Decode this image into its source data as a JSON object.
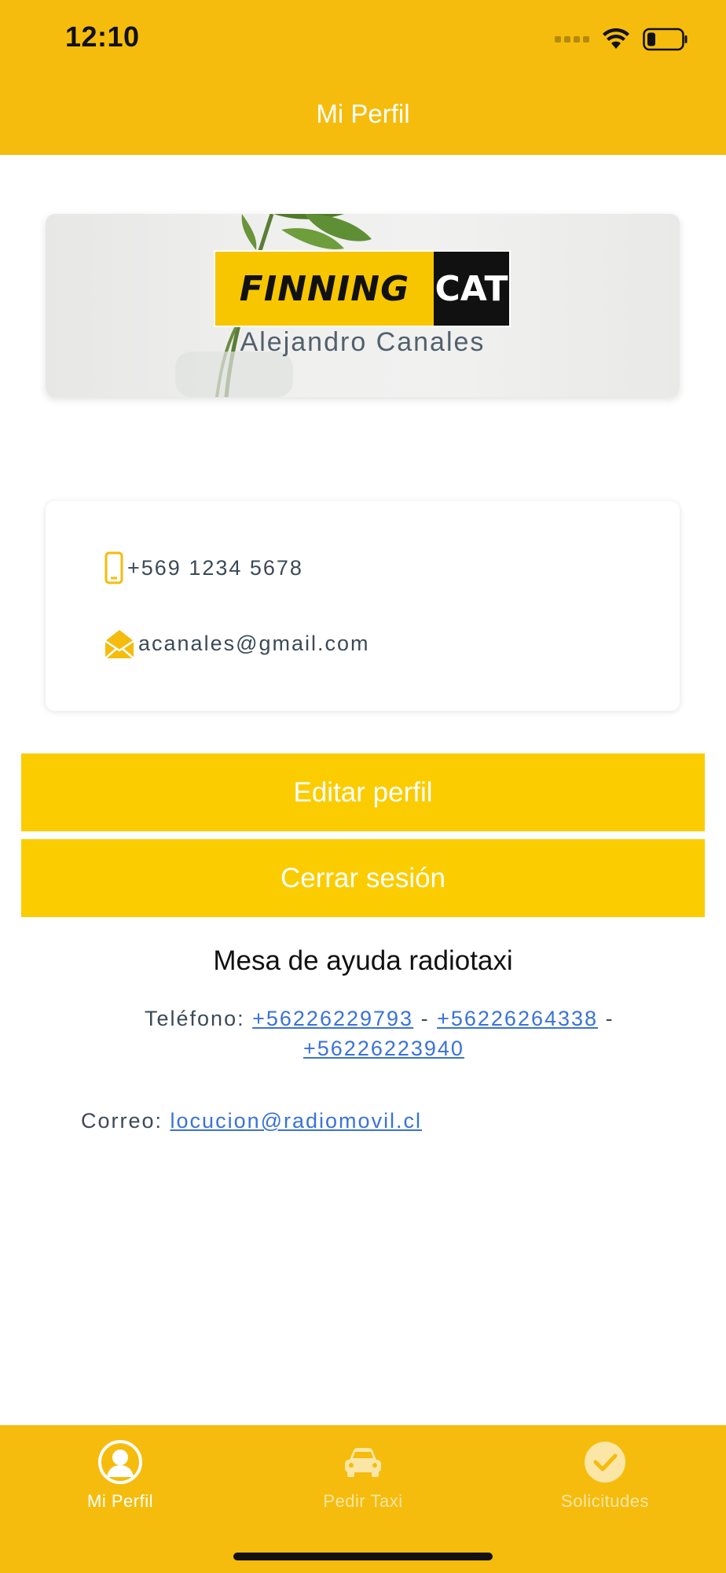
{
  "status_bar": {
    "time": "12:10"
  },
  "header": {
    "title": "Mi Perfil"
  },
  "profile": {
    "logo": {
      "left_text": "FINNING",
      "right_text": "CAT"
    },
    "name": "Alejandro Canales"
  },
  "contact": {
    "phone": "+569 1234 5678",
    "email": "acanales@gmail.com"
  },
  "buttons": {
    "edit": "Editar perfil",
    "logout": "Cerrar sesión"
  },
  "help": {
    "title": "Mesa de ayuda radiotaxi",
    "phone_label": "Teléfono:",
    "phones": [
      "+56226229793",
      "+56226264338",
      "+56226223940"
    ],
    "separator": "-",
    "mail_label": "Correo:",
    "mail": "locucion@radiomovil.cl"
  },
  "tabs": [
    {
      "label": "Mi Perfil",
      "active": true
    },
    {
      "label": "Pedir Taxi",
      "active": false
    },
    {
      "label": "Solicitudes",
      "active": false
    }
  ],
  "colors": {
    "brand_yellow": "#F5BC0D",
    "button_yellow": "#FBCC00",
    "link_blue": "#3A72D8"
  }
}
